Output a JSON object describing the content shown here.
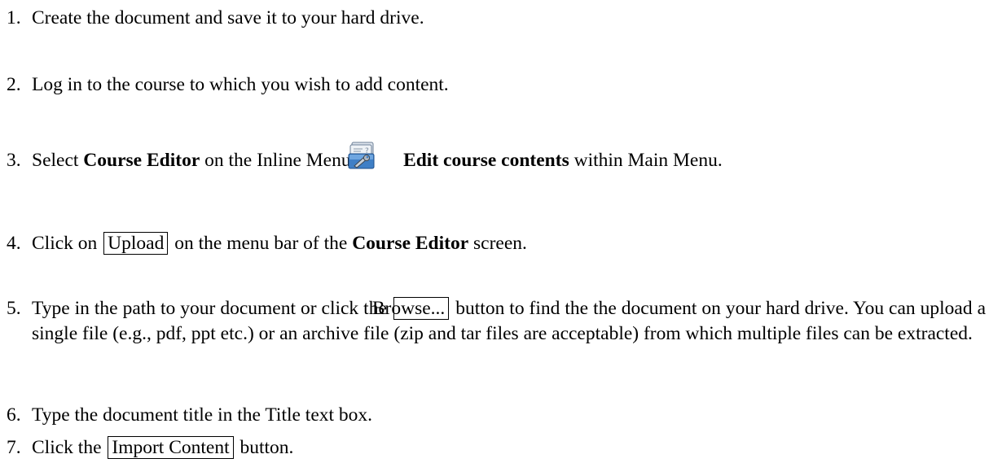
{
  "steps": [
    {
      "number": "1.",
      "text": "Create the document and save it to your hard drive."
    },
    {
      "number": "2.",
      "text": "Log in to the course to which you wish to add content."
    },
    {
      "number": "3.",
      "prefix": "Select",
      "course_editor": "Course Editor",
      "middle": "on the Inline Menu or",
      "icon": "edit-course-contents-icon",
      "edit_contents": "Edit course contents",
      "suffix": "within Main Menu."
    },
    {
      "number": "4.",
      "prefix": "Click on",
      "button": "Upload",
      "middle": "on the menu bar of the",
      "course_editor": "Course Editor",
      "suffix": "screen."
    },
    {
      "number": "5.",
      "prefix": "Type in the path to your document or click the",
      "button": "Browse...",
      "suffix": "button to find the the document on your hard drive. You can upload a single file (e.g., pdf, ppt etc.) or an archive file (zip and tar files are acceptable) from which multiple files can be extracted."
    },
    {
      "number": "6.",
      "text": "Type the document title in the Title text box."
    },
    {
      "number": "7.",
      "prefix": "Click the",
      "button": "Import Content",
      "suffix": "button."
    }
  ]
}
